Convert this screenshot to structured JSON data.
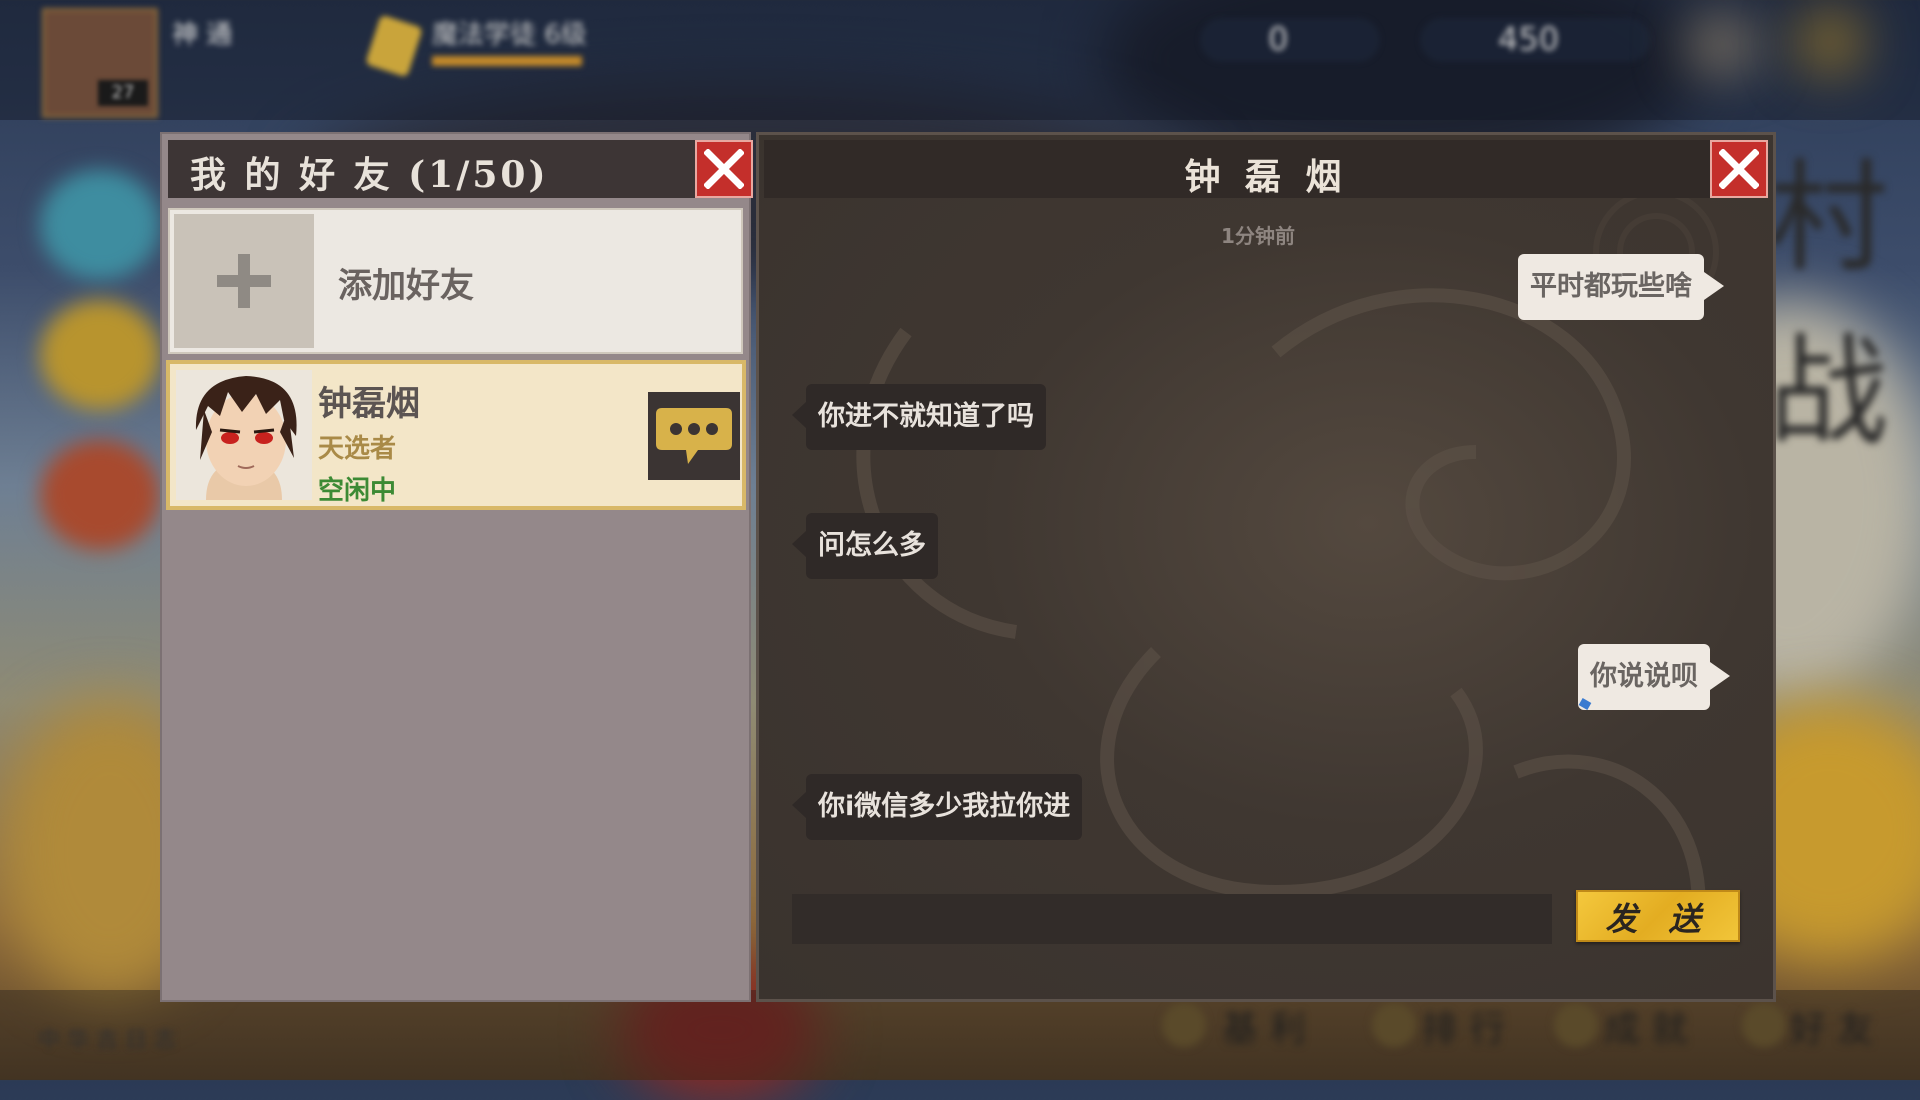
{
  "background": {
    "player_name": "神 通",
    "rank_label": "魔法学徒 6级",
    "resource_1": "0",
    "resource_2": "450",
    "side_tag": "村 战",
    "bottom_nav": [
      "基 利",
      "排 行",
      "成 就",
      "好 友"
    ],
    "bottom_left": "中 华 吉 日 志",
    "level_badge": "27"
  },
  "friends_panel": {
    "title": "我 的 好 友 (1/50)",
    "add_friend_label": "添加好友",
    "friends": [
      {
        "name": "钟磊烟",
        "title": "天选者",
        "status": "空闲中"
      }
    ]
  },
  "chat_panel": {
    "title": "钟 磊 烟",
    "timestamp": "1分钟前",
    "messages": [
      {
        "from": "me",
        "text": "平时都玩些啥"
      },
      {
        "from": "them",
        "text": "你进不就知道了吗"
      },
      {
        "from": "them",
        "text": "问怎么多"
      },
      {
        "from": "me",
        "text": "你说说呗"
      },
      {
        "from": "them",
        "text": "你i微信多少我拉你进"
      }
    ],
    "input_value": "",
    "send_label": "发 送"
  },
  "colors": {
    "accent_gold": "#e3ad22",
    "close_red": "#c42f2b",
    "status_green": "#3c8a34",
    "title_gold": "#a98a47"
  },
  "icons": [
    "close-icon",
    "plus-icon",
    "chat-bubble-icon",
    "avatar"
  ]
}
